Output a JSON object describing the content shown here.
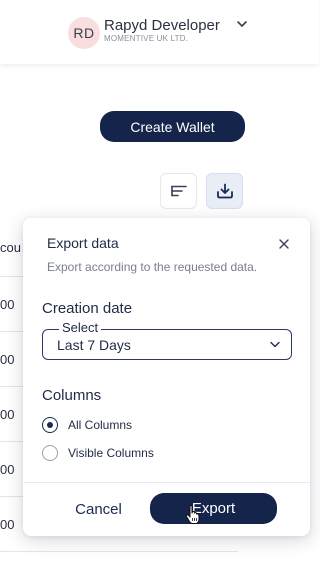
{
  "header": {
    "avatar_initials": "RD",
    "user_name": "Rapyd Developer",
    "organization": "MOMENTIVE UK LTD.",
    "chevron_icon": "chevron-down-icon"
  },
  "main": {
    "create_wallet_label": "Create Wallet",
    "filter_icon": "filter-lines-icon",
    "download_icon": "download-tray-icon",
    "table": {
      "column_fragment": "cou",
      "cell_fragments": [
        "00",
        "00",
        "00",
        "00",
        "00"
      ]
    }
  },
  "export_popup": {
    "title": "Export data",
    "subtitle": "Export according to the requested data.",
    "creation_date_label": "Creation date",
    "select_legend": "Select",
    "select_value": "Last 7 Days",
    "columns_label": "Columns",
    "options": [
      {
        "label": "All Columns",
        "checked": true
      },
      {
        "label": "Visible Columns",
        "checked": false
      }
    ],
    "cancel_label": "Cancel",
    "export_label": "Export"
  },
  "colors": {
    "primary": "#15244a",
    "avatar_bg": "#f8dede",
    "download_button_bg": "#e8edf6"
  }
}
